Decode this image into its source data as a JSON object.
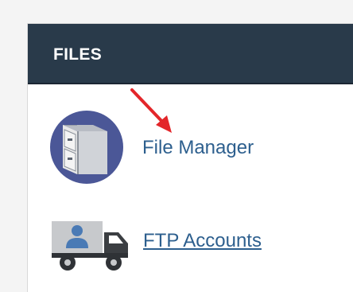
{
  "section": {
    "title": "FILES"
  },
  "items": [
    {
      "label": "File Manager",
      "icon": "file-cabinet-icon"
    },
    {
      "label": "FTP Accounts",
      "icon": "ftp-truck-user-icon"
    }
  ],
  "annotation": {
    "icon": "red-arrow-icon",
    "color": "#e3262a"
  },
  "colors": {
    "header_bg": "#293a4a",
    "link": "#2d5f8e",
    "icon_circle": "#4b5797"
  }
}
